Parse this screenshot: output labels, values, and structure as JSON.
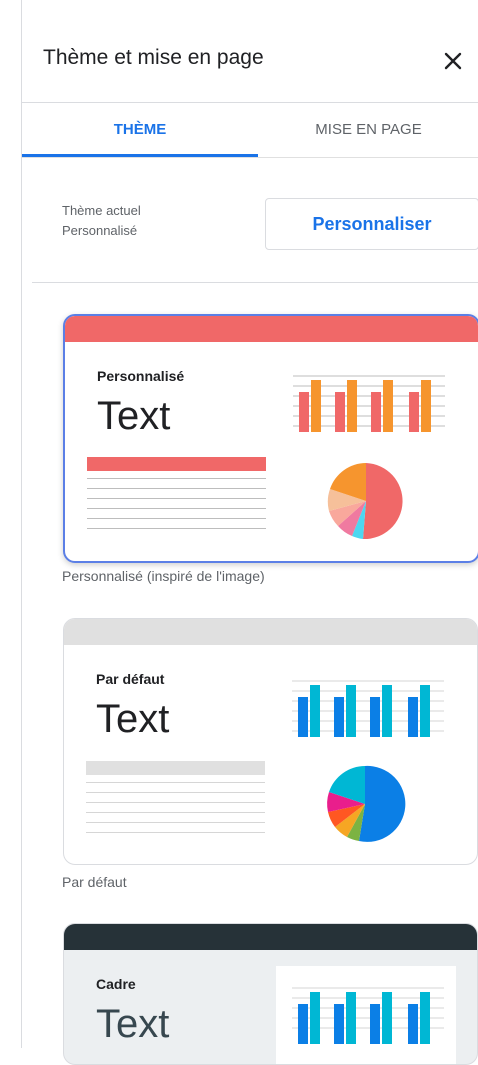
{
  "header": {
    "title": "Thème et mise en page",
    "close_icon": "close-icon"
  },
  "tabs": [
    {
      "label": "THÈME",
      "active": true
    },
    {
      "label": "MISE EN PAGE",
      "active": false
    }
  ],
  "current_theme": {
    "label": "Thème actuel",
    "value": "Personnalisé",
    "customize_label": "Personnaliser"
  },
  "themes": [
    {
      "name": "Personnalisé",
      "sample_text": "Text",
      "caption": "Personnalisé (inspiré de l'image)",
      "selected": true,
      "colors": {
        "accent": "#f06868",
        "secondary": "#f6952e",
        "bar": "#f06868"
      }
    },
    {
      "name": "Par défaut",
      "sample_text": "Text",
      "caption": "Par défaut",
      "selected": false,
      "colors": {
        "accent": "#0b7fe6",
        "secondary": "#00b7d4",
        "bar": "#e0e0e0"
      }
    },
    {
      "name": "Cadre",
      "sample_text": "Text",
      "caption": "",
      "selected": false,
      "colors": {
        "accent": "#0b7fe6",
        "secondary": "#00b7d4",
        "bar": "#263238"
      }
    }
  ]
}
